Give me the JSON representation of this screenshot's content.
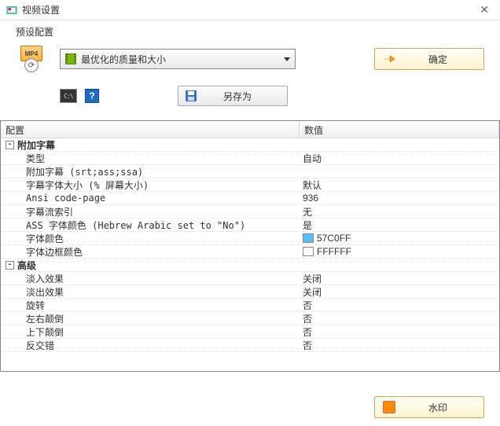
{
  "title": "视频设置",
  "preset_label": "预设配置",
  "preset_selected": "最优化的质量和大小",
  "mp4_badge": "MP4",
  "ok_button": "确定",
  "save_as_button": "另存为",
  "watermark_button": "水印",
  "headers": {
    "name": "配置",
    "value": "数值"
  },
  "groups": {
    "subs": "附加字幕",
    "adv": "高级"
  },
  "rows": {
    "type": {
      "label": "类型",
      "value": "自动"
    },
    "extra_sub": {
      "label": "附加字幕 (srt;ass;ssa)",
      "value": ""
    },
    "font_size": {
      "label": "字幕字体大小 (% 屏幕大小)",
      "value": "默认"
    },
    "ansi": {
      "label": "Ansi code-page",
      "value": "936"
    },
    "stream_idx": {
      "label": "字幕流索引",
      "value": "无"
    },
    "ass_color": {
      "label": "ASS 字体颜色 (Hebrew Arabic set to \"No\")",
      "value": "是"
    },
    "font_color": {
      "label": "字体颜色",
      "value": "57C0FF",
      "swatch": "#57C0FF"
    },
    "border_color": {
      "label": "字体边框颜色",
      "value": "FFFFFF",
      "swatch": "#FFFFFF"
    },
    "fade_in": {
      "label": "淡入效果",
      "value": "关闭"
    },
    "fade_out": {
      "label": "淡出效果",
      "value": "关闭"
    },
    "rotate": {
      "label": "旋转",
      "value": "否"
    },
    "flip_h": {
      "label": "左右颠倒",
      "value": "否"
    },
    "flip_v": {
      "label": "上下颠倒",
      "value": "否"
    },
    "deinterlace": {
      "label": "反交错",
      "value": "否"
    }
  }
}
